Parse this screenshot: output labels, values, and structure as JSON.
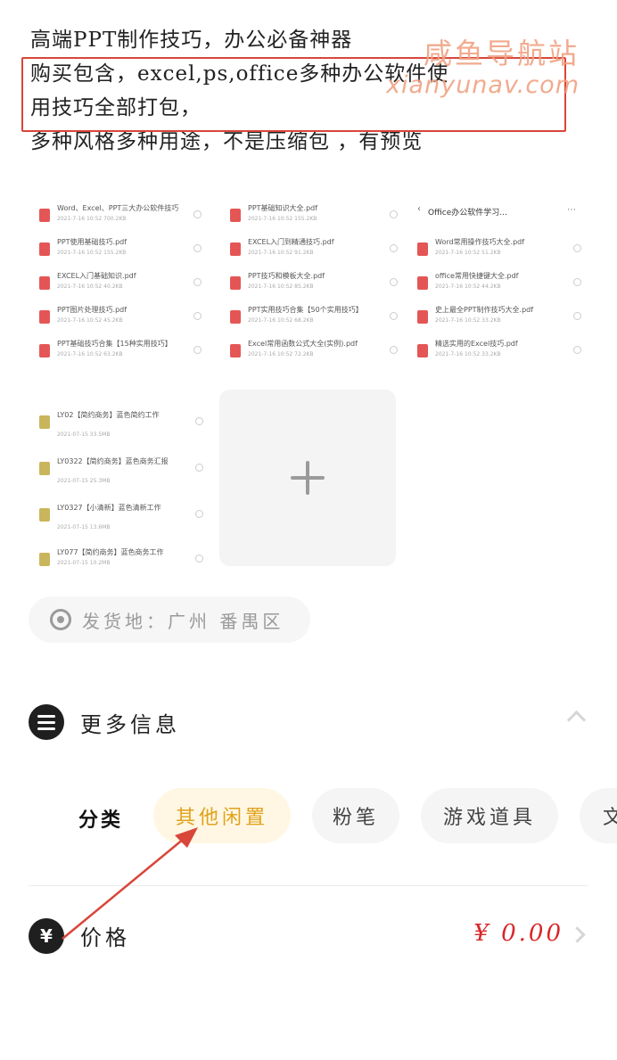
{
  "description": {
    "lines": [
      "高端PPT制作技巧，办公必备神器",
      "购买包含，excel,ps,office多种办公软件使",
      "用技巧全部打包，",
      "多种风格多种用途，不是压缩包 ，有预览"
    ]
  },
  "watermark": {
    "name": "咸鱼导航站",
    "url": "xianyunav.com"
  },
  "screenshots": {
    "shot1": [
      {
        "name": "Word、Excel、PPT三大办公软件技巧",
        "meta": "2021-7-16  10:52  700.2KB",
        "icon": "pdf"
      },
      {
        "name": "PPT使用基础技巧.pdf",
        "meta": "2021-7-16  10:52  155.2KB",
        "icon": "pdf"
      },
      {
        "name": "EXCEL入门基础知识.pdf",
        "meta": "2021-7-16  10:52  40.2KB",
        "icon": "pdf"
      },
      {
        "name": "PPT图片处理技巧.pdf",
        "meta": "2021-7-16  10:52  45.2KB",
        "icon": "pdf"
      },
      {
        "name": "PPT基础技巧合集【15种实用技巧】",
        "meta": "2021-7-16  10:52  63.2KB",
        "icon": "pdf"
      }
    ],
    "shot2": [
      {
        "name": "PPT基础知识大全.pdf",
        "meta": "2021-7-16  10:52  155.2KB",
        "icon": "pdf"
      },
      {
        "name": "EXCEL入门到精通技巧.pdf",
        "meta": "2021-7-16  10:52  91.2KB",
        "icon": "pdf"
      },
      {
        "name": "PPT技巧和模板大全.pdf",
        "meta": "2021-7-16  10:52  85.2KB",
        "icon": "pdf"
      },
      {
        "name": "PPT实用技巧合集【50个实用技巧】",
        "meta": "2021-7-16  10:52  68.2KB",
        "icon": "pdf"
      },
      {
        "name": "Excel常用函数公式大全(实例).pdf",
        "meta": "2021-7-16  10:52  72.2KB",
        "icon": "pdf"
      }
    ],
    "shot3": {
      "header": "Office办公软件学习...",
      "rows": [
        {
          "name": "Word常用操作技巧大全.pdf",
          "meta": "2021-7-16  10:52  51.2KB",
          "icon": "pdf"
        },
        {
          "name": "office常用快捷键大全.pdf",
          "meta": "2021-7-16  10:52  44.2KB",
          "icon": "pdf"
        },
        {
          "name": "史上最全PPT制作技巧大全.pdf",
          "meta": "2021-7-16  10:52  33.2KB",
          "icon": "pdf"
        },
        {
          "name": "精选实用的Excel技巧.pdf",
          "meta": "2021-7-16  10:52  33.2KB",
          "icon": "pdf"
        }
      ]
    },
    "shot4": [
      {
        "name": "LY02【简约商务】蓝色简约工作",
        "meta": "2021-07-15  33.5MB",
        "icon": "zip"
      },
      {
        "name": "LY0322【简约商务】蓝色商务汇报",
        "meta": "2021-07-15  25.3MB",
        "icon": "zip"
      },
      {
        "name": "LY0327【小清新】蓝色清新工作",
        "meta": "2021-07-15  13.6MB",
        "icon": "zip"
      },
      {
        "name": "LY077【简约商务】蓝色商务工作",
        "meta": "2021-07-15  10.2MB",
        "icon": "zip"
      }
    ]
  },
  "location": {
    "label": "发货地：广州 番禺区"
  },
  "more_info": {
    "title": "更多信息"
  },
  "category": {
    "label": "分类",
    "chips": [
      "其他闲置",
      "粉笔",
      "游戏道具",
      "文"
    ],
    "active_index": 0
  },
  "price": {
    "label": "价格",
    "value": "¥ 0.00",
    "icon": "¥"
  },
  "colors": {
    "accent": "#e0a21b",
    "price": "#d8262a",
    "highlight_box": "#d9463a",
    "watermark": "#f0a383"
  }
}
